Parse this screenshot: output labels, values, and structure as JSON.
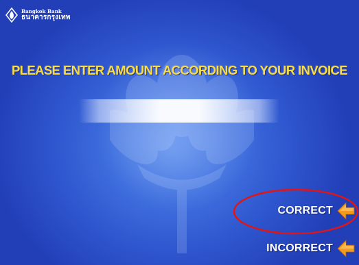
{
  "bank": {
    "name_en": "Bangkok Bank",
    "name_th": "ธนาคารกรุงเทพ",
    "logo_icon": "bangkok-bank-logo-icon"
  },
  "screen": {
    "prompt": "PLEASE ENTER AMOUNT ACCORDING TO YOUR INVOICE",
    "amount_value": ""
  },
  "options": {
    "correct_label": "CORRECT",
    "incorrect_label": "INCORRECT",
    "arrow_icon": "arrow-left-icon",
    "highlighted": "CORRECT"
  },
  "colors": {
    "background": "#2f57cf",
    "prompt_text": "#f4dc4a",
    "option_text": "#ffffff",
    "arrow": "#f29b20",
    "highlight_ring": "#e11515"
  }
}
